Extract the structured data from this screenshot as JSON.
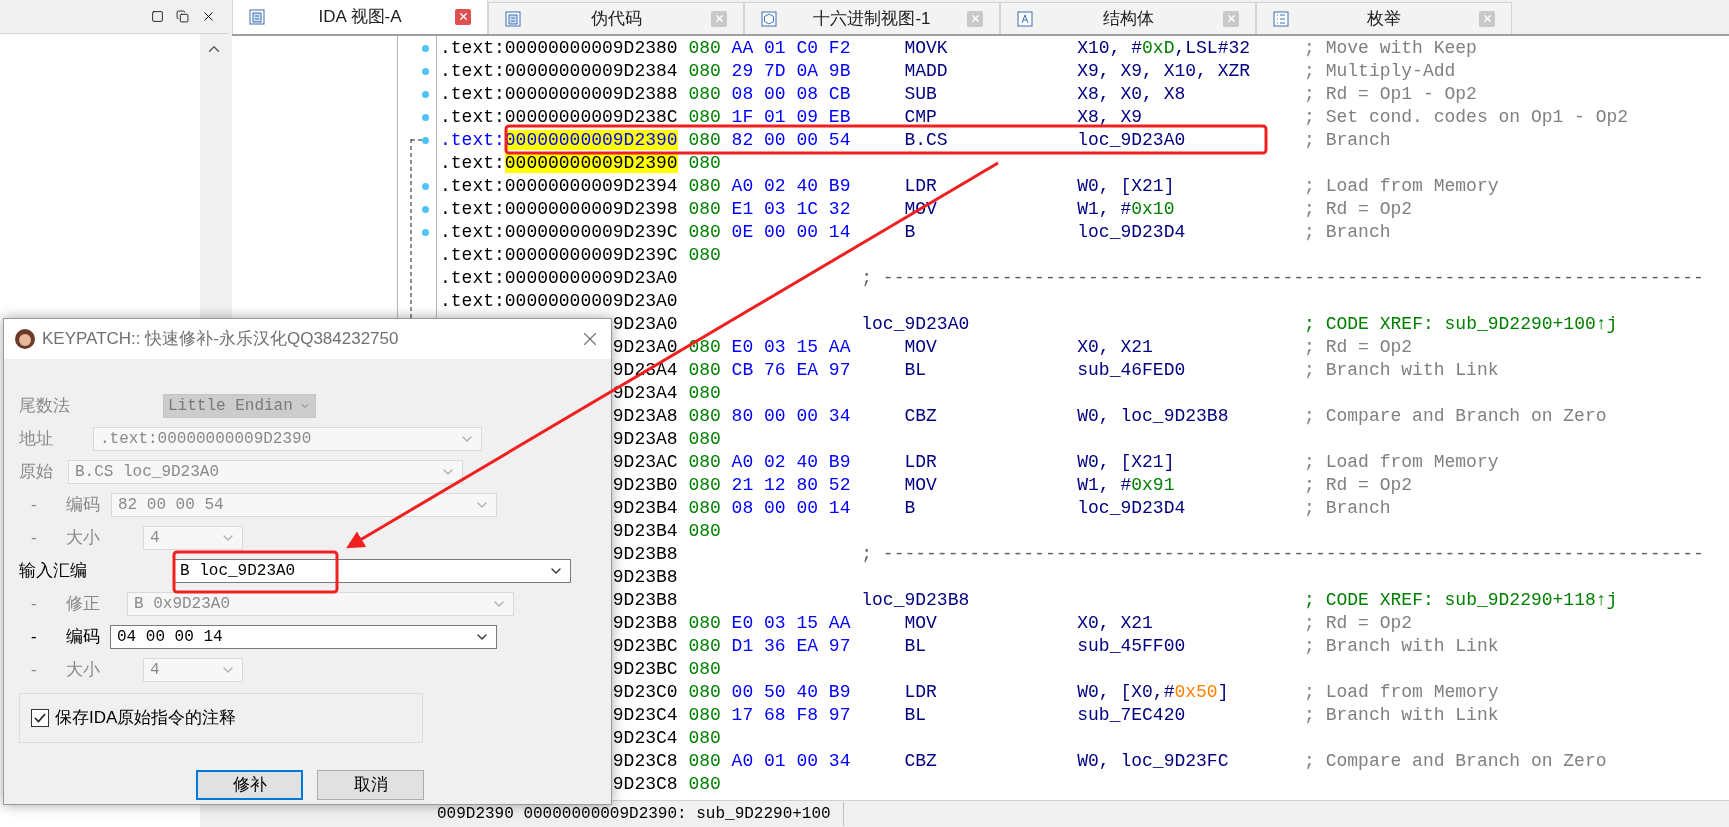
{
  "tabs": [
    {
      "label": "IDA 视图-A",
      "selected": true
    },
    {
      "label": "伪代码",
      "selected": false
    },
    {
      "label": "十六进制视图-1",
      "selected": false
    },
    {
      "label": "结构体",
      "selected": false
    },
    {
      "label": "枚举",
      "selected": false
    }
  ],
  "rows": [
    {
      "kind": "insn",
      "segment": ".text:",
      "address": "00000000009D2380",
      "prefix": "080",
      "bytes": "AA 01 C0 F2",
      "mnemonic": "MOVK",
      "operands": [
        {
          "text": "X10, #"
        },
        {
          "text": "0xD",
          "kind": "number"
        },
        {
          "text": ",LSL#32"
        }
      ],
      "comment": "; Move with Keep",
      "dot": true,
      "selected": false,
      "highlighted": false
    },
    {
      "kind": "insn",
      "segment": ".text:",
      "address": "00000000009D2384",
      "prefix": "080",
      "bytes": "29 7D 0A 9B",
      "mnemonic": "MADD",
      "operands": [
        {
          "text": "X9, X9, X10, XZR"
        }
      ],
      "comment": "; Multiply-Add",
      "dot": true,
      "selected": false,
      "highlighted": false
    },
    {
      "kind": "insn",
      "segment": ".text:",
      "address": "00000000009D2388",
      "prefix": "080",
      "bytes": "08 00 08 CB",
      "mnemonic": "SUB",
      "operands": [
        {
          "text": "X8, X0, X8"
        }
      ],
      "comment": "; Rd = Op1 - Op2",
      "dot": true,
      "selected": false,
      "highlighted": false
    },
    {
      "kind": "insn",
      "segment": ".text:",
      "address": "00000000009D238C",
      "prefix": "080",
      "bytes": "1F 01 09 EB",
      "mnemonic": "CMP",
      "operands": [
        {
          "text": "X8, X9"
        }
      ],
      "comment": "; Set cond. codes on Op1 - Op2",
      "dot": true,
      "selected": false,
      "highlighted": false
    },
    {
      "kind": "insn",
      "segment": ".text:",
      "address": "00000000009D2390",
      "prefix": "080",
      "bytes": "82 00 00 54",
      "mnemonic": "B.CS",
      "operands": [
        {
          "text": "loc_9D23A0"
        }
      ],
      "comment": "; Branch",
      "dot": true,
      "selected": true,
      "highlighted": true
    },
    {
      "kind": "blank",
      "segment": ".text:",
      "address": "00000000009D2390",
      "prefix": "080",
      "dot": false,
      "selected": false,
      "highlighted": true
    },
    {
      "kind": "insn",
      "segment": ".text:",
      "address": "00000000009D2394",
      "prefix": "080",
      "bytes": "A0 02 40 B9",
      "mnemonic": "LDR",
      "operands": [
        {
          "text": "W0, [X21]"
        }
      ],
      "comment": "; Load from Memory",
      "dot": true,
      "selected": false,
      "highlighted": false
    },
    {
      "kind": "insn",
      "segment": ".text:",
      "address": "00000000009D2398",
      "prefix": "080",
      "bytes": "E1 03 1C 32",
      "mnemonic": "MOV",
      "operands": [
        {
          "text": "W1, #"
        },
        {
          "text": "0x10",
          "kind": "number"
        }
      ],
      "comment": "; Rd = Op2",
      "dot": true,
      "selected": false,
      "highlighted": false
    },
    {
      "kind": "insn",
      "segment": ".text:",
      "address": "00000000009D239C",
      "prefix": "080",
      "bytes": "0E 00 00 14",
      "mnemonic": "B",
      "operands": [
        {
          "text": "loc_9D23D4"
        }
      ],
      "comment": "; Branch",
      "dot": true,
      "selected": false,
      "highlighted": false
    },
    {
      "kind": "blank",
      "segment": ".text:",
      "address": "00000000009D239C",
      "prefix": "080",
      "dot": false,
      "selected": false,
      "highlighted": false
    },
    {
      "kind": "separator",
      "segment": ".text:",
      "address": "00000000009D23A0",
      "text": "; ----------------------------------------------------------------------------",
      "dot": false,
      "selected": false,
      "highlighted": false
    },
    {
      "kind": "addr",
      "segment": ".text:",
      "address": "00000000009D23A0",
      "dot": false,
      "selected": false,
      "highlighted": false
    },
    {
      "kind": "label",
      "address": "9D23A0",
      "label": "loc_9D23A0",
      "comment": "; CODE XREF: sub_9D2290+100↑j",
      "dot": false,
      "selected": false,
      "highlighted": false
    },
    {
      "kind": "insn",
      "address": "9D23A0",
      "prefix": "080",
      "bytes": "E0 03 15 AA",
      "mnemonic": "MOV",
      "operands": [
        {
          "text": "X0, X21"
        }
      ],
      "comment": "; Rd = Op2",
      "dot": false,
      "selected": false,
      "highlighted": false
    },
    {
      "kind": "insn",
      "address": "9D23A4",
      "prefix": "080",
      "bytes": "CB 76 EA 97",
      "mnemonic": "BL",
      "operands": [
        {
          "text": "sub_46FED0"
        }
      ],
      "comment": "; Branch with Link",
      "dot": false,
      "selected": false,
      "highlighted": false
    },
    {
      "kind": "blank",
      "address": "9D23A4",
      "prefix": "080",
      "dot": false,
      "selected": false,
      "highlighted": false
    },
    {
      "kind": "insn",
      "address": "9D23A8",
      "prefix": "080",
      "bytes": "80 00 00 34",
      "mnemonic": "CBZ",
      "operands": [
        {
          "text": "W0, loc_9D23B8"
        }
      ],
      "comment": "; Compare and Branch on Zero",
      "dot": false,
      "selected": false,
      "highlighted": false
    },
    {
      "kind": "blank",
      "address": "9D23A8",
      "prefix": "080",
      "dot": false,
      "selected": false,
      "highlighted": false
    },
    {
      "kind": "insn",
      "address": "9D23AC",
      "prefix": "080",
      "bytes": "A0 02 40 B9",
      "mnemonic": "LDR",
      "operands": [
        {
          "text": "W0, [X21]"
        }
      ],
      "comment": "; Load from Memory",
      "dot": false,
      "selected": false,
      "highlighted": false
    },
    {
      "kind": "insn",
      "address": "9D23B0",
      "prefix": "080",
      "bytes": "21 12 80 52",
      "mnemonic": "MOV",
      "operands": [
        {
          "text": "W1, #"
        },
        {
          "text": "0x91",
          "kind": "number"
        }
      ],
      "comment": "; Rd = Op2",
      "dot": false,
      "selected": false,
      "highlighted": false
    },
    {
      "kind": "insn",
      "address": "9D23B4",
      "prefix": "080",
      "bytes": "08 00 00 14",
      "mnemonic": "B",
      "operands": [
        {
          "text": "loc_9D23D4"
        }
      ],
      "comment": "; Branch",
      "dot": false,
      "selected": false,
      "highlighted": false
    },
    {
      "kind": "blank",
      "address": "9D23B4",
      "prefix": "080",
      "dot": false,
      "selected": false,
      "highlighted": false
    },
    {
      "kind": "separator",
      "address": "9D23B8",
      "text": "; ----------------------------------------------------------------------------",
      "dot": false,
      "selected": false,
      "highlighted": false
    },
    {
      "kind": "addr",
      "address": "9D23B8",
      "dot": false,
      "selected": false,
      "highlighted": false
    },
    {
      "kind": "label",
      "address": "9D23B8",
      "label": "loc_9D23B8",
      "comment": "; CODE XREF: sub_9D2290+118↑j",
      "dot": false,
      "selected": false,
      "highlighted": false
    },
    {
      "kind": "insn",
      "address": "9D23B8",
      "prefix": "080",
      "bytes": "E0 03 15 AA",
      "mnemonic": "MOV",
      "operands": [
        {
          "text": "X0, X21"
        }
      ],
      "comment": "; Rd = Op2",
      "dot": false,
      "selected": false,
      "highlighted": false
    },
    {
      "kind": "insn",
      "address": "9D23BC",
      "prefix": "080",
      "bytes": "D1 36 EA 97",
      "mnemonic": "BL",
      "operands": [
        {
          "text": "sub_45FF00"
        }
      ],
      "comment": "; Branch with Link",
      "dot": false,
      "selected": false,
      "highlighted": false
    },
    {
      "kind": "blank",
      "address": "9D23BC",
      "prefix": "080",
      "dot": false,
      "selected": false,
      "highlighted": false
    },
    {
      "kind": "insn",
      "address": "9D23C0",
      "prefix": "080",
      "bytes": "00 50 40 B9",
      "mnemonic": "LDR",
      "operands": [
        {
          "text": "W0, [X0,#"
        },
        {
          "text": "0x50",
          "kind": "offset"
        },
        {
          "text": "]"
        }
      ],
      "comment": "; Load from Memory",
      "dot": false,
      "selected": false,
      "highlighted": false
    },
    {
      "kind": "insn",
      "address": "9D23C4",
      "prefix": "080",
      "bytes": "17 68 F8 97",
      "mnemonic": "BL",
      "operands": [
        {
          "text": "sub_7EC420"
        }
      ],
      "comment": "; Branch with Link",
      "dot": false,
      "selected": false,
      "highlighted": false
    },
    {
      "kind": "blank",
      "address": "9D23C4",
      "prefix": "080",
      "dot": false,
      "selected": false,
      "highlighted": false
    },
    {
      "kind": "insn",
      "address": "9D23C8",
      "prefix": "080",
      "bytes": "A0 01 00 34",
      "mnemonic": "CBZ",
      "operands": [
        {
          "text": "W0, loc_9D23FC"
        }
      ],
      "comment": "; Compare and Branch on Zero",
      "dot": false,
      "selected": false,
      "highlighted": false
    },
    {
      "kind": "blank",
      "address": "9D23C8",
      "prefix": "080",
      "dot": false,
      "selected": false,
      "highlighted": false
    }
  ],
  "status_bar": "009D2390 00000000009D2390: sub_9D2290+100",
  "dialog": {
    "title": "KEYPATCH:: 快速修补-永乐汉化QQ384232750",
    "fields": [
      {
        "kind": "dropdown",
        "label": "尾数法",
        "value": "Little Endian",
        "disabled": true
      },
      {
        "kind": "combo",
        "label": "地址",
        "value": ".text:00000000009D2390",
        "disabled": true
      },
      {
        "kind": "combo",
        "label": "原始",
        "value": "B.CS loc_9D23A0",
        "disabled": true
      },
      {
        "kind": "combo",
        "marker": "-",
        "label": "编码",
        "value": "82 00 00 54",
        "disabled": true
      },
      {
        "kind": "combo",
        "marker": "-",
        "label": "大小",
        "value": "4",
        "disabled": true
      },
      {
        "kind": "combo",
        "label": "输入汇编",
        "value": "B loc_9D23A0",
        "disabled": false
      },
      {
        "kind": "combo",
        "marker": "-",
        "label": "修正",
        "value": "B 0x9D23A0",
        "disabled": true
      },
      {
        "kind": "combo",
        "marker": "-",
        "label": "编码",
        "value": "04 00 00 14",
        "disabled": false
      },
      {
        "kind": "combo",
        "marker": "-",
        "label": "大小",
        "value": "4",
        "disabled": true
      }
    ],
    "checkbox": {
      "label": "保存IDA原始指令的注释",
      "checked": true
    },
    "buttons": [
      {
        "label": "修补",
        "default": true
      },
      {
        "label": "取消",
        "default": false
      }
    ]
  }
}
